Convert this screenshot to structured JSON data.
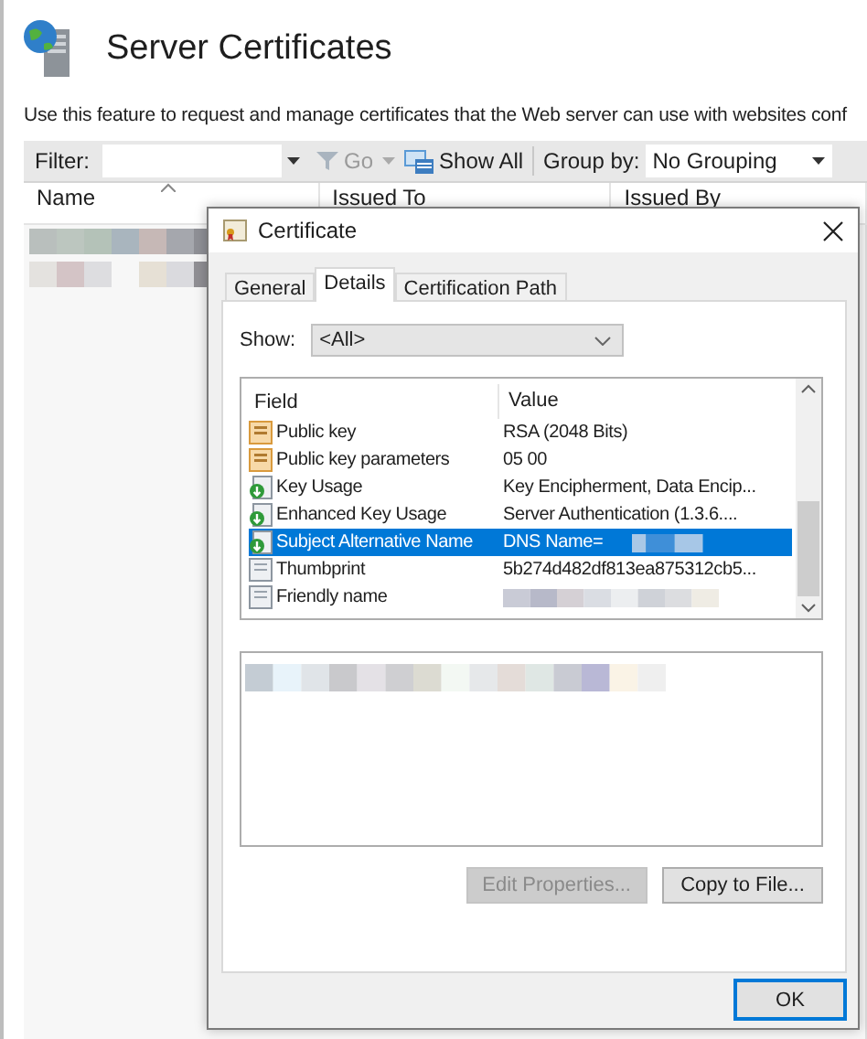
{
  "page": {
    "title": "Server Certificates",
    "description": "Use this feature to request and manage certificates that the Web server can use with websites conf"
  },
  "toolbar": {
    "filter_label": "Filter:",
    "go": "Go",
    "show_all": "Show All",
    "group_by_label": "Group by:",
    "group_by_value": "No Grouping"
  },
  "list": {
    "columns": [
      {
        "label": "Name",
        "sorted": true
      },
      {
        "label": "Issued To",
        "sorted": false
      },
      {
        "label": "Issued By",
        "sorted": false
      }
    ],
    "rows": [
      {
        "redacted": true
      },
      {
        "redacted": true
      }
    ]
  },
  "dialog": {
    "title": "Certificate",
    "tabs": [
      {
        "label": "General",
        "selected": false
      },
      {
        "label": "Details",
        "selected": true
      },
      {
        "label": "Certification Path",
        "selected": false
      }
    ],
    "show_label": "Show:",
    "show_value": "<All>",
    "columns": [
      "Field",
      "Value"
    ],
    "fields": [
      {
        "kind": "property",
        "field": "Public key",
        "value": "RSA (2048 Bits)",
        "selected": false,
        "redacted": false
      },
      {
        "kind": "property",
        "field": "Public key parameters",
        "value": "05 00",
        "selected": false,
        "redacted": false
      },
      {
        "kind": "extension",
        "field": "Key Usage",
        "value": "Key Encipherment, Data Encip...",
        "selected": false,
        "redacted": false
      },
      {
        "kind": "extension",
        "field": "Enhanced Key Usage",
        "value": "Server Authentication (1.3.6....",
        "selected": false,
        "redacted": false
      },
      {
        "kind": "extension",
        "field": "Subject Alternative Name",
        "value": "DNS Name=",
        "selected": true,
        "redacted": true
      },
      {
        "kind": "plain",
        "field": "Thumbprint",
        "value": "5b274d482df813ea875312cb5...",
        "selected": false,
        "redacted": false
      },
      {
        "kind": "plain",
        "field": "Friendly name",
        "selected": false,
        "redacted": true
      }
    ],
    "details_redacted": true,
    "buttons": [
      {
        "label": "Edit Properties...",
        "disabled": true
      },
      {
        "label": "Copy to File...",
        "disabled": false
      }
    ],
    "ok": "OK"
  }
}
